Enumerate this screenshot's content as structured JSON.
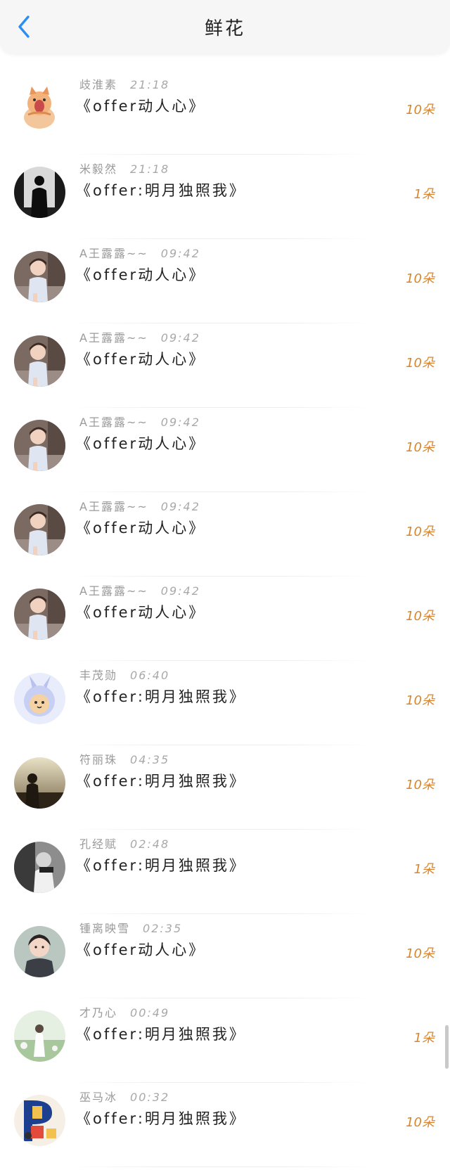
{
  "header": {
    "title": "鲜花"
  },
  "colors": {
    "accent": "#2c8ff0",
    "count": "#d7862f"
  },
  "rows": [
    {
      "user": "歧淮素",
      "time": "21:18",
      "gift": "《offer动人心》",
      "count": "10朵",
      "avatar": "cat"
    },
    {
      "user": "米毅然",
      "time": "21:18",
      "gift": "《offer:明月独照我》",
      "count": "1朵",
      "avatar": "silhouette"
    },
    {
      "user": "A王露露~~",
      "time": "09:42",
      "gift": "《offer动人心》",
      "count": "10朵",
      "avatar": "child"
    },
    {
      "user": "A王露露~~",
      "time": "09:42",
      "gift": "《offer动人心》",
      "count": "10朵",
      "avatar": "child"
    },
    {
      "user": "A王露露~~",
      "time": "09:42",
      "gift": "《offer动人心》",
      "count": "10朵",
      "avatar": "child"
    },
    {
      "user": "A王露露~~",
      "time": "09:42",
      "gift": "《offer动人心》",
      "count": "10朵",
      "avatar": "child"
    },
    {
      "user": "A王露露~~",
      "time": "09:42",
      "gift": "《offer动人心》",
      "count": "10朵",
      "avatar": "child"
    },
    {
      "user": "丰茂勋",
      "time": "06:40",
      "gift": "《offer:明月独照我》",
      "count": "10朵",
      "avatar": "bunny"
    },
    {
      "user": "符丽珠",
      "time": "04:35",
      "gift": "《offer:明月独照我》",
      "count": "10朵",
      "avatar": "sunset"
    },
    {
      "user": "孔经赋",
      "time": "02:48",
      "gift": "《offer:明月独照我》",
      "count": "1朵",
      "avatar": "bw"
    },
    {
      "user": "锺离映雪",
      "time": "02:35",
      "gift": "《offer动人心》",
      "count": "10朵",
      "avatar": "boy"
    },
    {
      "user": "才乃心",
      "time": "00:49",
      "gift": "《offer:明月独照我》",
      "count": "1朵",
      "avatar": "field"
    },
    {
      "user": "巫马冰",
      "time": "00:32",
      "gift": "《offer:明月独照我》",
      "count": "10朵",
      "avatar": "letter"
    }
  ]
}
